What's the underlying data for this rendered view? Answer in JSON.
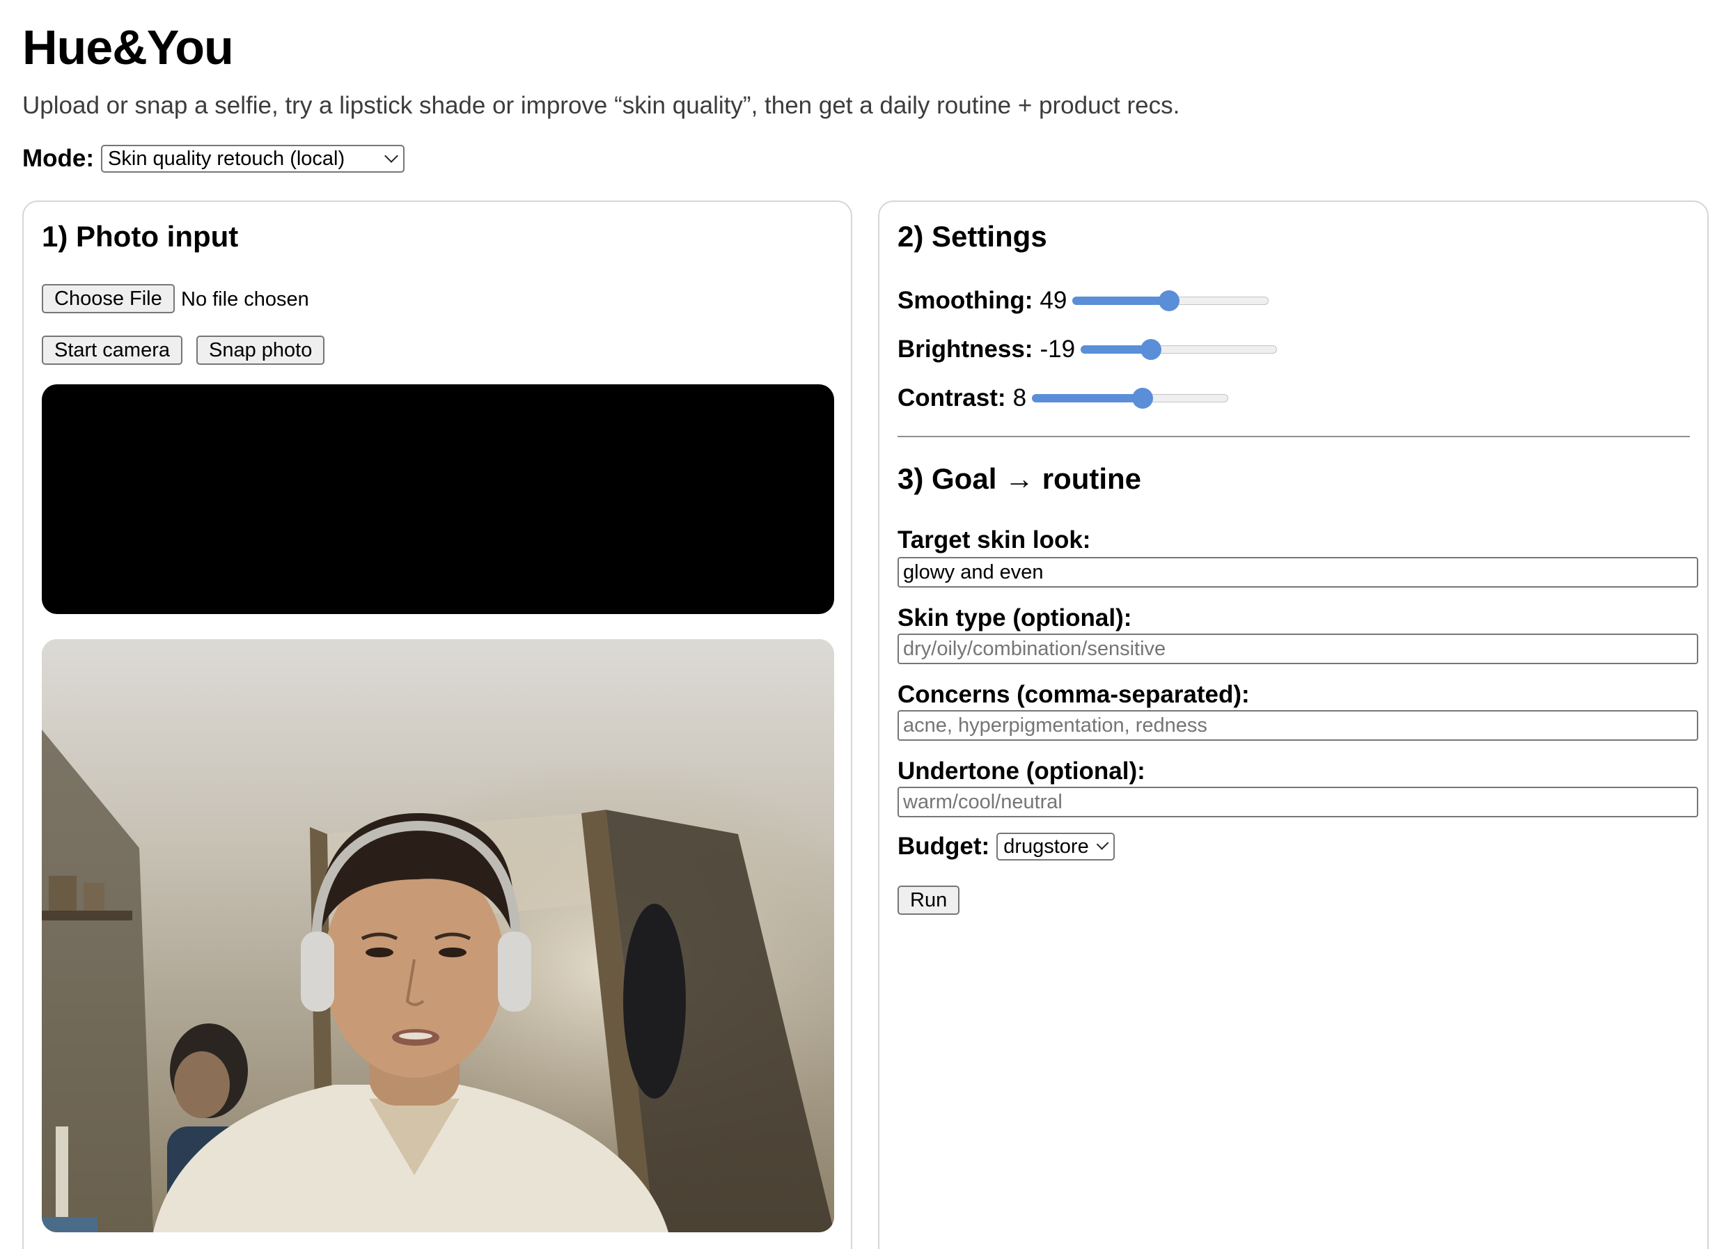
{
  "app": {
    "title": "Hue&You",
    "subtitle": "Upload or snap a selfie, try a lipstick shade or improve “skin quality”, then get a daily routine + product recs."
  },
  "mode": {
    "label": "Mode:",
    "selected": "Skin quality retouch (local)"
  },
  "photo_input": {
    "heading": "1) Photo input",
    "choose_file_label": "Choose File",
    "file_status": "No file chosen",
    "start_camera_label": "Start camera",
    "snap_photo_label": "Snap photo"
  },
  "settings": {
    "heading": "2) Settings",
    "sliders": [
      {
        "label": "Smoothing:",
        "value": "49",
        "fraction": 0.49
      },
      {
        "label": "Brightness:",
        "value": "-19",
        "fraction": 0.34
      },
      {
        "label": "Contrast:",
        "value": "8",
        "fraction": 0.57
      }
    ]
  },
  "routine": {
    "heading": "3) Goal → routine",
    "fields": [
      {
        "label": "Target skin look:",
        "value": "glowy and even",
        "placeholder": ""
      },
      {
        "label": "Skin type (optional):",
        "value": "",
        "placeholder": "dry/oily/combination/sensitive"
      },
      {
        "label": "Concerns (comma-separated):",
        "value": "",
        "placeholder": "acne, hyperpigmentation, redness"
      },
      {
        "label": "Undertone (optional):",
        "value": "",
        "placeholder": "warm/cool/neutral"
      }
    ],
    "budget_label": "Budget:",
    "budget_selected": "drugstore",
    "run_label": "Run"
  },
  "colors": {
    "accent": "#5b8ed8",
    "panel_border": "#d6d6d6",
    "video_bg": "#000000"
  }
}
